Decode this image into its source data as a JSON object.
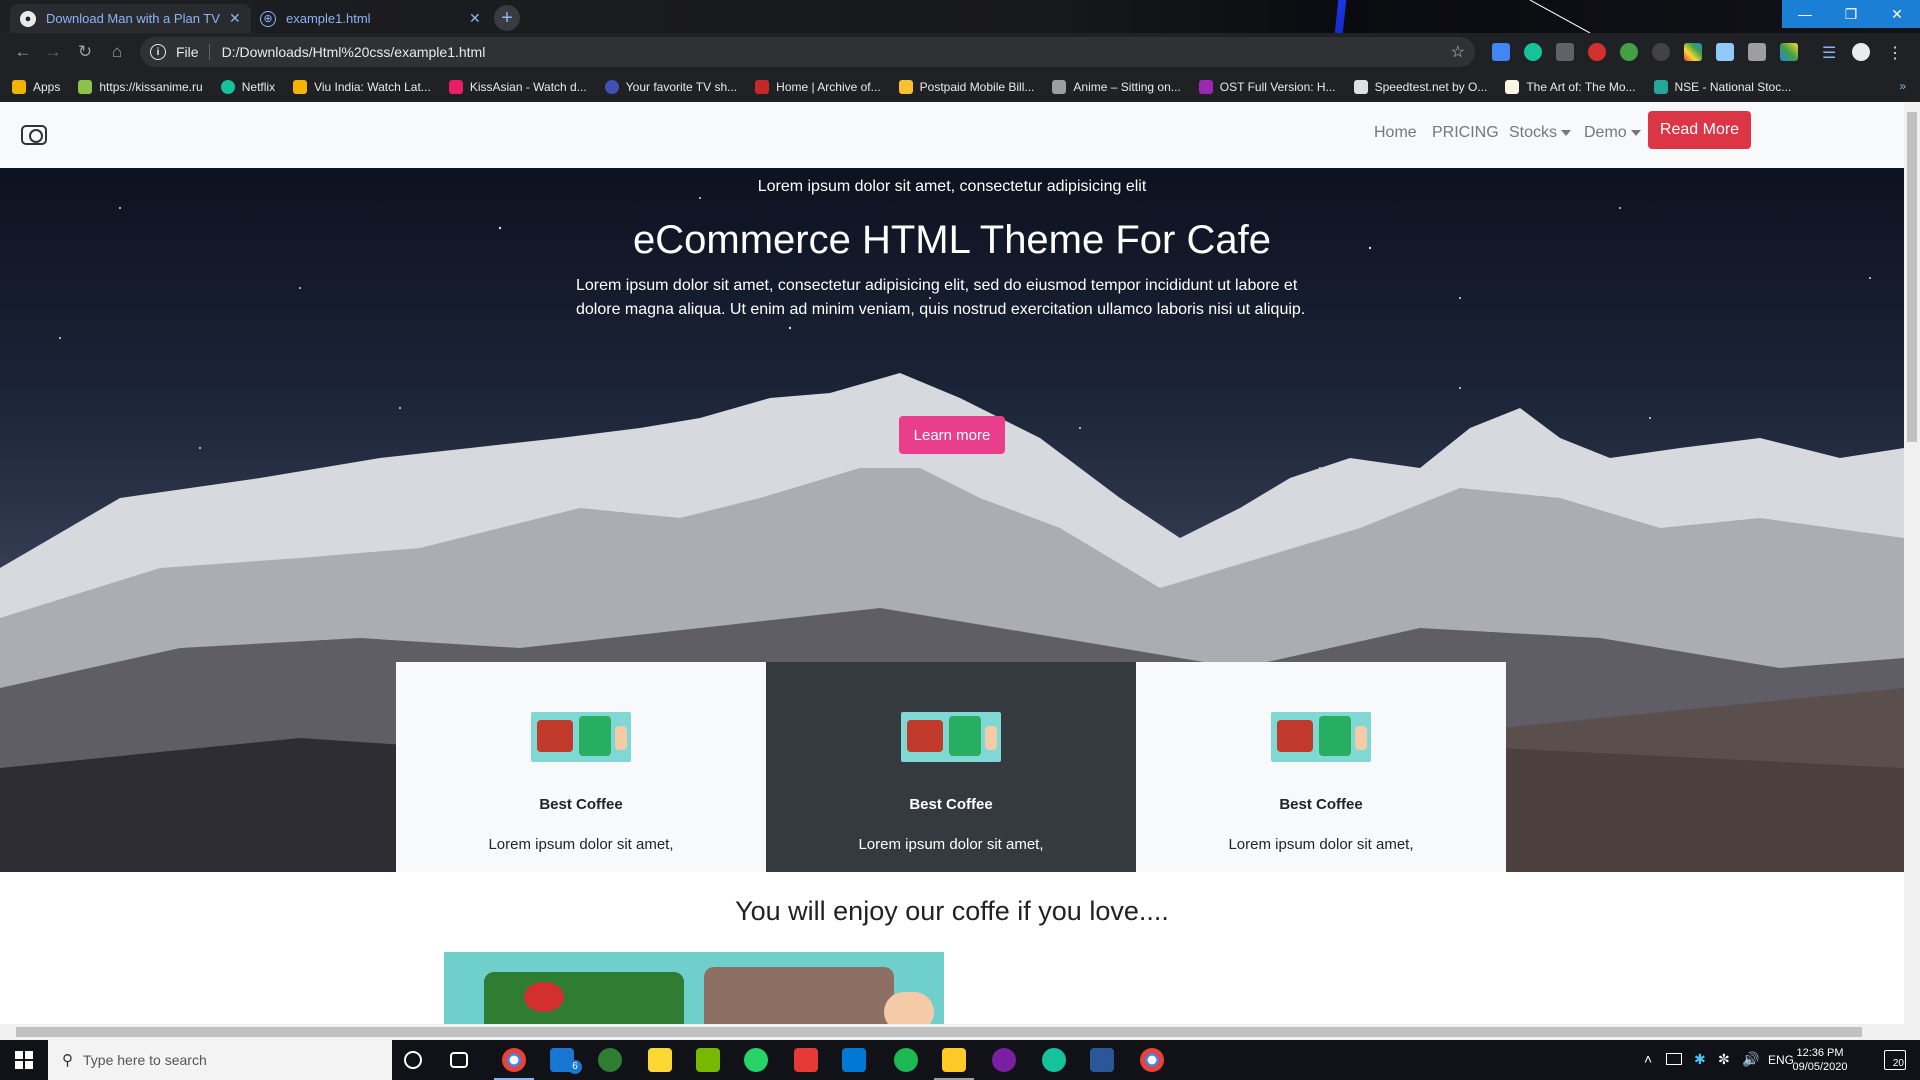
{
  "browser": {
    "tabs": [
      {
        "title": "Download Man with a Plan TV Se",
        "active": true
      },
      {
        "title": "example1.html",
        "active": false
      }
    ],
    "omnibox": {
      "scheme": "File",
      "url": "D:/Downloads/Html%20css/example1.html"
    },
    "bookmarks": [
      {
        "label": "Apps",
        "color": "#f2b400"
      },
      {
        "label": "https://kissanime.ru",
        "color": "#8bc34a"
      },
      {
        "label": "Netflix",
        "color": "#15c39a"
      },
      {
        "label": "Viu India: Watch Lat...",
        "color": "#f4b400"
      },
      {
        "label": "KissAsian - Watch d...",
        "color": "#e91e63"
      },
      {
        "label": "Your favorite TV sh...",
        "color": "#3f51b5"
      },
      {
        "label": "Home | Archive of...",
        "color": "#c62828"
      },
      {
        "label": "Postpaid Mobile Bill...",
        "color": "#fbc02d"
      },
      {
        "label": "Anime – Sitting on...",
        "color": "#9e9e9e"
      },
      {
        "label": "OST Full Version: H...",
        "color": "#9c27b0"
      },
      {
        "label": "Speedtest.net by O...",
        "color": "#e0e0e0"
      },
      {
        "label": "The Art of: The Mo...",
        "color": "#fff8e1"
      },
      {
        "label": "NSE - National Stoc...",
        "color": "#26a69a"
      }
    ],
    "bookmarks_more": "»"
  },
  "site": {
    "nav": {
      "home": "Home",
      "pricing": "PRICING",
      "stocks": "Stocks",
      "demo": "Demo",
      "read_more": "Read More"
    },
    "hero": {
      "kicker": "Lorem ipsum dolor sit amet, consectetur adipisicing elit",
      "title": "eCommerce HTML Theme For Cafe",
      "lead": "Lorem ipsum dolor sit amet, consectetur adipisicing elit, sed do eiusmod tempor incididunt ut labore et dolore magna aliqua. Ut enim ad minim veniam, quis nostrud exercitation ullamco laboris nisi ut aliquip.",
      "button": "Learn more"
    },
    "cards": [
      {
        "title": "Best Coffee",
        "text": "Lorem ipsum dolor sit amet,",
        "theme": "light"
      },
      {
        "title": "Best Coffee",
        "text": "Lorem ipsum dolor sit amet,",
        "theme": "dark"
      },
      {
        "title": "Best Coffee",
        "text": "Lorem ipsum dolor sit amet,",
        "theme": "light"
      }
    ],
    "section_heading": "You will enjoy our coffe if you love...."
  },
  "taskbar": {
    "search_placeholder": "Type here to search",
    "mail_badge": "6",
    "language": "ENG",
    "time": "12:36 PM",
    "date": "09/05/2020",
    "notifications": "20"
  },
  "colors": {
    "accent_red": "#dc3545",
    "accent_pink": "#e83e8c",
    "card_dark": "#343a40",
    "card_light": "#f8f9fa"
  }
}
